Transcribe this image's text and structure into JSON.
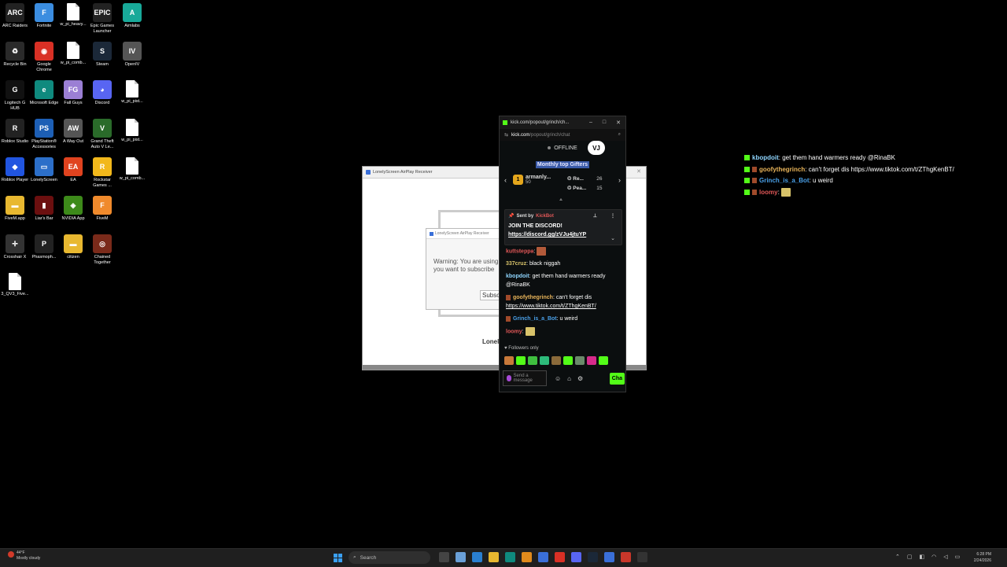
{
  "desktop": {
    "icons": [
      {
        "label": "ARC Raiders",
        "glyph": "ARC",
        "color": "#222"
      },
      {
        "label": "Fortnite",
        "glyph": "F",
        "color": "#3b8de0"
      },
      {
        "label": "w_pi_heavy...",
        "glyph": "",
        "color": "doc"
      },
      {
        "label": "Epic Games Launcher",
        "glyph": "EPIC",
        "color": "#222"
      },
      {
        "label": "Aimlabs",
        "glyph": "A",
        "color": "#18a999"
      },
      {
        "label": "Recycle Bin",
        "glyph": "♻",
        "color": "#2a2a2a"
      },
      {
        "label": "Google Chrome",
        "glyph": "◉",
        "color": "#d93025"
      },
      {
        "label": "w_pi_comb...",
        "glyph": "",
        "color": "doc"
      },
      {
        "label": "Steam",
        "glyph": "S",
        "color": "#1b2838"
      },
      {
        "label": "OpenIV",
        "glyph": "IV",
        "color": "#555"
      },
      {
        "label": "Logitech G HUB",
        "glyph": "G",
        "color": "#111"
      },
      {
        "label": "Microsoft Edge",
        "glyph": "e",
        "color": "#0f8a7e"
      },
      {
        "label": "Fall Guys",
        "glyph": "FG",
        "color": "#9b7fd4"
      },
      {
        "label": "Discord",
        "glyph": "◕",
        "color": "#5865f2"
      },
      {
        "label": "w_pi_pist...",
        "glyph": "",
        "color": "doc"
      },
      {
        "label": "Roblox Studio",
        "glyph": "R",
        "color": "#222"
      },
      {
        "label": "PlayStation® Accessories",
        "glyph": "PS",
        "color": "#1d5fb5"
      },
      {
        "label": "A Way Out",
        "glyph": "AW",
        "color": "#555"
      },
      {
        "label": "Grand Theft Auto V Le...",
        "glyph": "V",
        "color": "#2a6b2a"
      },
      {
        "label": "w_pi_pist...",
        "glyph": "",
        "color": "doc"
      },
      {
        "label": "Roblox Player",
        "glyph": "◆",
        "color": "#2155e0"
      },
      {
        "label": "LonelyScreen",
        "glyph": "▭",
        "color": "#2c6fc9"
      },
      {
        "label": "EA",
        "glyph": "EA",
        "color": "#e0431f"
      },
      {
        "label": "Rockstar Games ...",
        "glyph": "R",
        "color": "#f2b81b"
      },
      {
        "label": "w_pi_comb...",
        "glyph": "",
        "color": "doc"
      },
      {
        "label": "FiveM.app",
        "glyph": "▬",
        "color": "#e8b830"
      },
      {
        "label": "Liar's Bar",
        "glyph": "▮",
        "color": "#6b0f0f"
      },
      {
        "label": "NVIDIA App",
        "glyph": "◈",
        "color": "#3d8a1a"
      },
      {
        "label": "FiveM",
        "glyph": "F",
        "color": "#f08a2c"
      },
      {
        "label": "",
        "glyph": "",
        "color": "none"
      },
      {
        "label": "Crosshair X",
        "glyph": "✛",
        "color": "#333"
      },
      {
        "label": "Phasmoph...",
        "glyph": "P",
        "color": "#222"
      },
      {
        "label": "citizen",
        "glyph": "▬",
        "color": "#e8b830"
      },
      {
        "label": "Chained Together",
        "glyph": "◎",
        "color": "#7a2a1a"
      },
      {
        "label": "",
        "glyph": "",
        "color": "none"
      },
      {
        "label": "3_QV3_Five...",
        "glyph": "",
        "color": "doc"
      }
    ]
  },
  "lonelyscreen": {
    "title": "LonelyScreen AirPlay Receiver",
    "dialog_title": "LonelyScreen AirPlay Receiver",
    "warning_line1": "Warning: You are using",
    "warning_line2": "you want to subscribe",
    "subscribe_label": "Subscr",
    "brand": "Lonel"
  },
  "kick": {
    "window_title": "kick.com/popout/grinch/ch...",
    "url_domain": "kick.com",
    "url_path": "/popout/grinch/chat",
    "status": "OFFLINE",
    "vj_badge": "VJ",
    "gifters_title": "Monthly top Gifters",
    "gifter1_name": "armanly...",
    "gifter1_count": "50",
    "gifter1_rank": "1",
    "gifter2_name": "Re...",
    "gifter2_count": "26",
    "gifter3_name": "Pea...",
    "gifter3_count": "15",
    "pinned_sent_by": "Sent by",
    "pinned_sender": "KickBot",
    "pinned_line1": "JOIN THE DISCORD!",
    "pinned_link": "https://discord.gg/zVJu4jtuYP",
    "messages": [
      {
        "user": "kuttsteppa",
        "color": "#e05757",
        "text": "",
        "emote": true
      },
      {
        "user": "337cruz",
        "color": "#d8c36a",
        "text": "black niggah"
      },
      {
        "user": "kbopdoit",
        "color": "#8fd6ff",
        "text": "get them hand warmers ready @RinaBK"
      },
      {
        "user": "goofythegrinch",
        "color": "#e8b45a",
        "text": "can't forget dis",
        "link": "https://www.tiktok.com/t/ZThgKenBT/"
      },
      {
        "user": "Grinch_is_a_Bot",
        "color": "#4aa0e8",
        "text": "u weird"
      },
      {
        "user": "loomy",
        "color": "#e05757",
        "text": "",
        "emote": true
      }
    ],
    "followers_only": "Followers only",
    "input_placeholder": "Send a message",
    "chat_button": "Cha"
  },
  "overlay": {
    "lines": [
      {
        "user": "kbopdoit",
        "color": "#8fd6ff",
        "text": "get them hand warmers ready @RinaBK"
      },
      {
        "user": "goofythegrinch",
        "color": "#e8b45a",
        "text": "can't forget dis https://www.tiktok.com/t/ZThgKenBT/"
      },
      {
        "user": "Grinch_is_a_Bot",
        "color": "#4aa0e8",
        "text": "u weird"
      },
      {
        "user": "loomy",
        "color": "#e05757",
        "text": ""
      }
    ]
  },
  "taskbar": {
    "weather_temp": "44°F",
    "weather_desc": "Mostly cloudy",
    "search_label": "Search",
    "time": "6:28 PM",
    "date": "2/24/2026"
  }
}
